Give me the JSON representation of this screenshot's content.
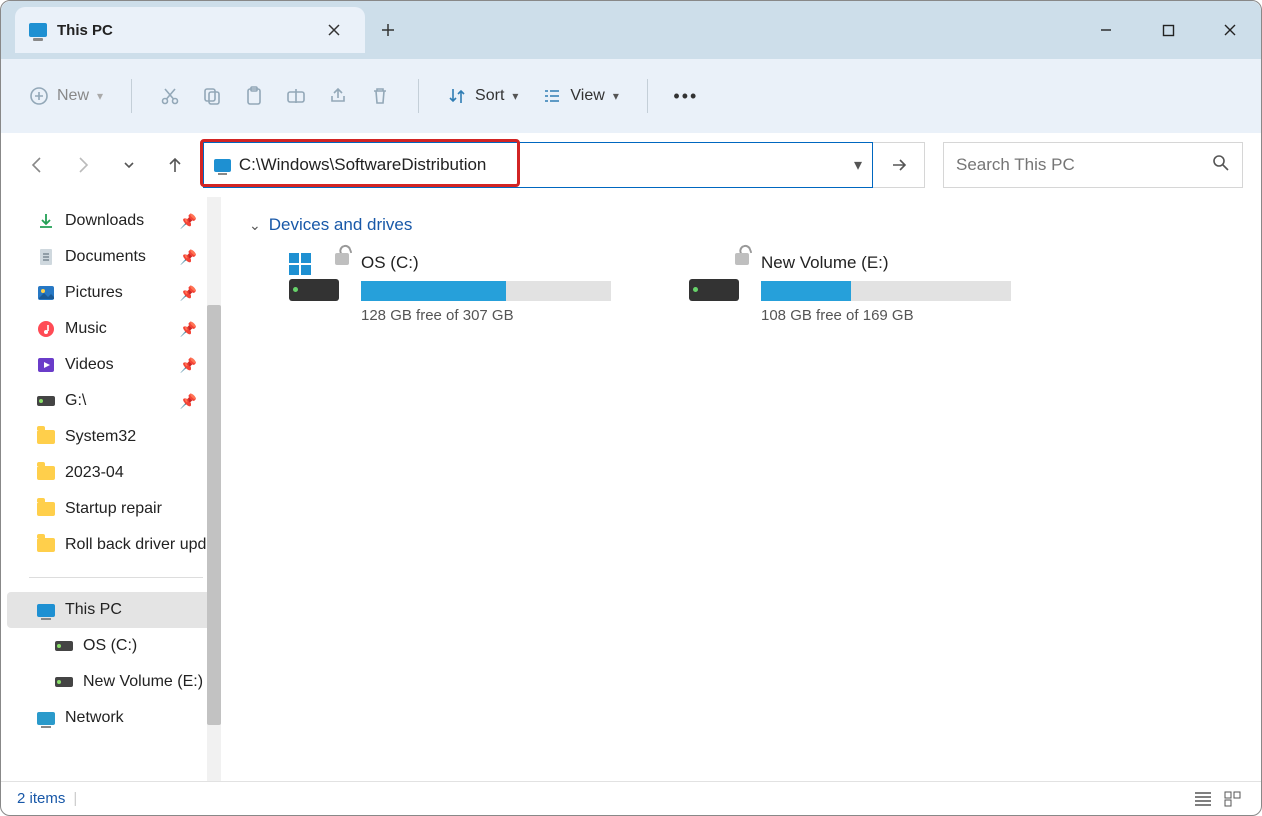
{
  "tab": {
    "title": "This PC"
  },
  "toolbar": {
    "new_label": "New",
    "sort_label": "Sort",
    "view_label": "View"
  },
  "address": {
    "value": "C:\\Windows\\SoftwareDistribution"
  },
  "search": {
    "placeholder": "Search This PC"
  },
  "sidebar": {
    "quick": [
      {
        "label": "Downloads",
        "icon": "download",
        "pinned": true
      },
      {
        "label": "Documents",
        "icon": "doc",
        "pinned": true
      },
      {
        "label": "Pictures",
        "icon": "pic",
        "pinned": true
      },
      {
        "label": "Music",
        "icon": "music",
        "pinned": true
      },
      {
        "label": "Videos",
        "icon": "video",
        "pinned": true
      },
      {
        "label": "G:\\",
        "icon": "drive",
        "pinned": true
      },
      {
        "label": "System32",
        "icon": "folder",
        "pinned": false
      },
      {
        "label": "2023-04",
        "icon": "folder",
        "pinned": false
      },
      {
        "label": "Startup repair",
        "icon": "folder",
        "pinned": false
      },
      {
        "label": "Roll back driver update",
        "icon": "folder",
        "pinned": false
      }
    ],
    "thispc": {
      "label": "This PC"
    },
    "volumes": [
      {
        "label": "OS (C:)"
      },
      {
        "label": "New Volume (E:)"
      }
    ],
    "network": {
      "label": "Network"
    }
  },
  "section": {
    "header": "Devices and drives"
  },
  "drives": [
    {
      "name": "OS (C:)",
      "free_text": "128 GB free of 307 GB",
      "fill_pct": 58,
      "has_winlogo": true
    },
    {
      "name": "New Volume (E:)",
      "free_text": "108 GB free of 169 GB",
      "fill_pct": 36,
      "has_winlogo": false
    }
  ],
  "status": {
    "items_text": "2 items"
  }
}
